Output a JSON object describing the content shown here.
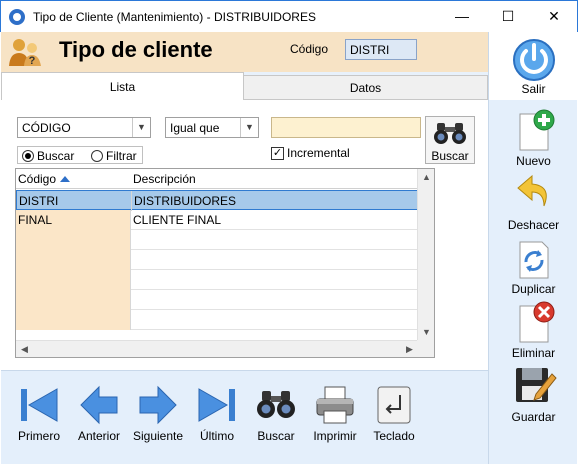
{
  "window": {
    "title": "Tipo de Cliente (Mantenimiento) - DISTRIBUIDORES",
    "minimize": "—",
    "maximize": "☐",
    "close": "✕"
  },
  "header": {
    "title": "Tipo de cliente",
    "code_label": "Código",
    "code_value": "DISTRI"
  },
  "tabs": [
    {
      "label": "Lista",
      "active": true
    },
    {
      "label": "Datos",
      "active": false
    }
  ],
  "search": {
    "field_value": "CÓDIGO",
    "operator_value": "Igual que",
    "input_value": "",
    "mode_options": [
      {
        "label": "Buscar",
        "selected": true
      },
      {
        "label": "Filtrar",
        "selected": false
      }
    ],
    "incremental_label": "Incremental",
    "incremental_checked": true,
    "check_mark": "✓",
    "button_label": "Buscar"
  },
  "grid": {
    "columns": [
      "Código",
      "Descripción"
    ],
    "rows": [
      {
        "code": "DISTRI",
        "desc": "DISTRIBUIDORES",
        "selected": true
      },
      {
        "code": "FINAL",
        "desc": "CLIENTE FINAL",
        "selected": false
      }
    ],
    "empty_rows": 5
  },
  "navigation": {
    "first": "Primero",
    "previous": "Anterior",
    "next": "Siguiente",
    "last": "Último",
    "search": "Buscar",
    "print": "Imprimir",
    "keyboard": "Teclado"
  },
  "toolbar": {
    "exit": "Salir",
    "new": "Nuevo",
    "undo": "Deshacer",
    "duplicate": "Duplicar",
    "delete": "Eliminar",
    "save": "Guardar"
  },
  "colors": {
    "accent": "#2e6fc8",
    "header_band": "#f7e3c5",
    "search_input": "#fdf1d0",
    "selected_row": "#a6c9ea",
    "code_column": "#fbe6c8",
    "toolbar_bg": "#e4effb"
  }
}
